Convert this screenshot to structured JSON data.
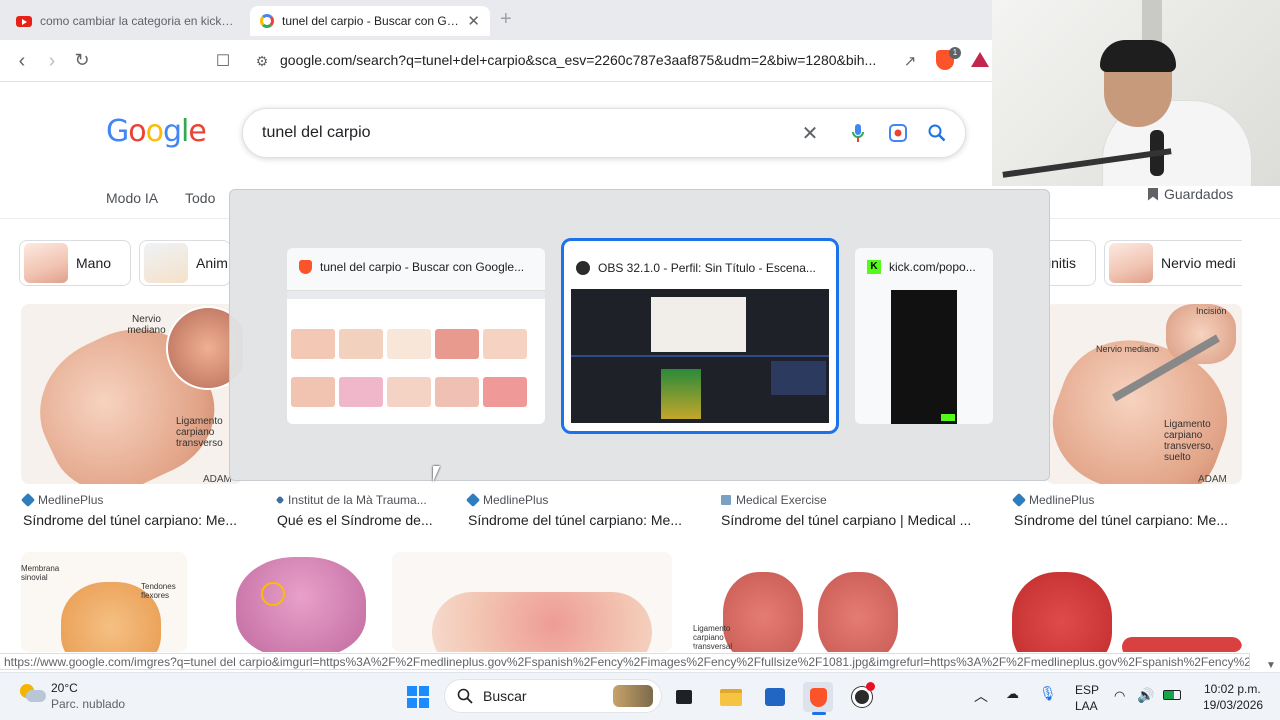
{
  "tabs": [
    {
      "title": "como cambiar la categoria en kick - Y",
      "icon": "youtube-icon"
    },
    {
      "title": "tunel del carpio - Buscar con Goo",
      "icon": "google-icon"
    }
  ],
  "address": {
    "url": "google.com/search?q=tunel+del+carpio&sca_esv=2260c787e3aaf875&udm=2&biw=1280&bih..."
  },
  "brave_badge": "1",
  "logo": {
    "letters": [
      "G",
      "o",
      "o",
      "g",
      "l",
      "e"
    ],
    "colors": [
      "#4285f4",
      "#ea4335",
      "#fbbc05",
      "#4285f4",
      "#34a853",
      "#ea4335"
    ]
  },
  "search": {
    "query": "tunel del carpio"
  },
  "nav": {
    "mode_ai": "Modo IA",
    "all": "Todo",
    "saved": "Guardados"
  },
  "chips": [
    {
      "label": "Mano"
    },
    {
      "label": "Anim"
    },
    {
      "label": "initis"
    },
    {
      "label": "Nervio medi"
    }
  ],
  "results_row1": [
    {
      "source": "MedlinePlus",
      "title": "Síndrome del túnel carpiano: Me..."
    },
    {
      "source": "Institut de la Mà Trauma...",
      "title": "Qué es el Síndrome de..."
    },
    {
      "source": "MedlinePlus",
      "title": "Síndrome del túnel carpiano: Me..."
    },
    {
      "source": "Medical Exercise",
      "title": "Síndrome del túnel carpiano | Medical ..."
    },
    {
      "source": "MedlinePlus",
      "title": "Síndrome del túnel carpiano: Me..."
    }
  ],
  "image_labels": {
    "nervio_mediano": "Nervio mediano",
    "ligamento": "Ligamento carpiano transverso",
    "adam": "ADAM",
    "nervio_mediano_small": "Nervio mediano",
    "incision": "Incisión",
    "ligamento_suelto": "Ligamento carpiano transverso, suelto",
    "membrana": "Membrana sinovial",
    "tendones": "Tendones flexores",
    "ligamento2": "Ligamento carpiano transversal"
  },
  "switcher": [
    {
      "title": "tunel del carpio - Buscar con Google...",
      "icon": "brave-icon"
    },
    {
      "title": "OBS 32.1.0 - Perfil: Sin Título - Escena...",
      "icon": "obs-icon"
    },
    {
      "title": "kick.com/popo...",
      "icon": "kick-icon"
    }
  ],
  "status_url": "https://www.google.com/imgres?q=tunel del carpio&imgurl=https%3A%2F%2Fmedlineplus.gov%2Fspanish%2Fency%2Fimages%2Fency%2Ffullsize%2F1081.jpg&imgrefurl=https%3A%2F%2Fmedlineplus.gov%2Fspanish%2Fency%2F...",
  "taskbar": {
    "weather_temp": "20°C",
    "weather_desc": "Parc. nublado",
    "search_placeholder": "Buscar",
    "lang1": "ESP",
    "lang2": "LAA",
    "time": "10:02 p.m.",
    "date": "19/03/2026"
  },
  "colors": {
    "accent": "#1a73e8",
    "brave": "#fb542b",
    "kick": "#53fc18"
  }
}
